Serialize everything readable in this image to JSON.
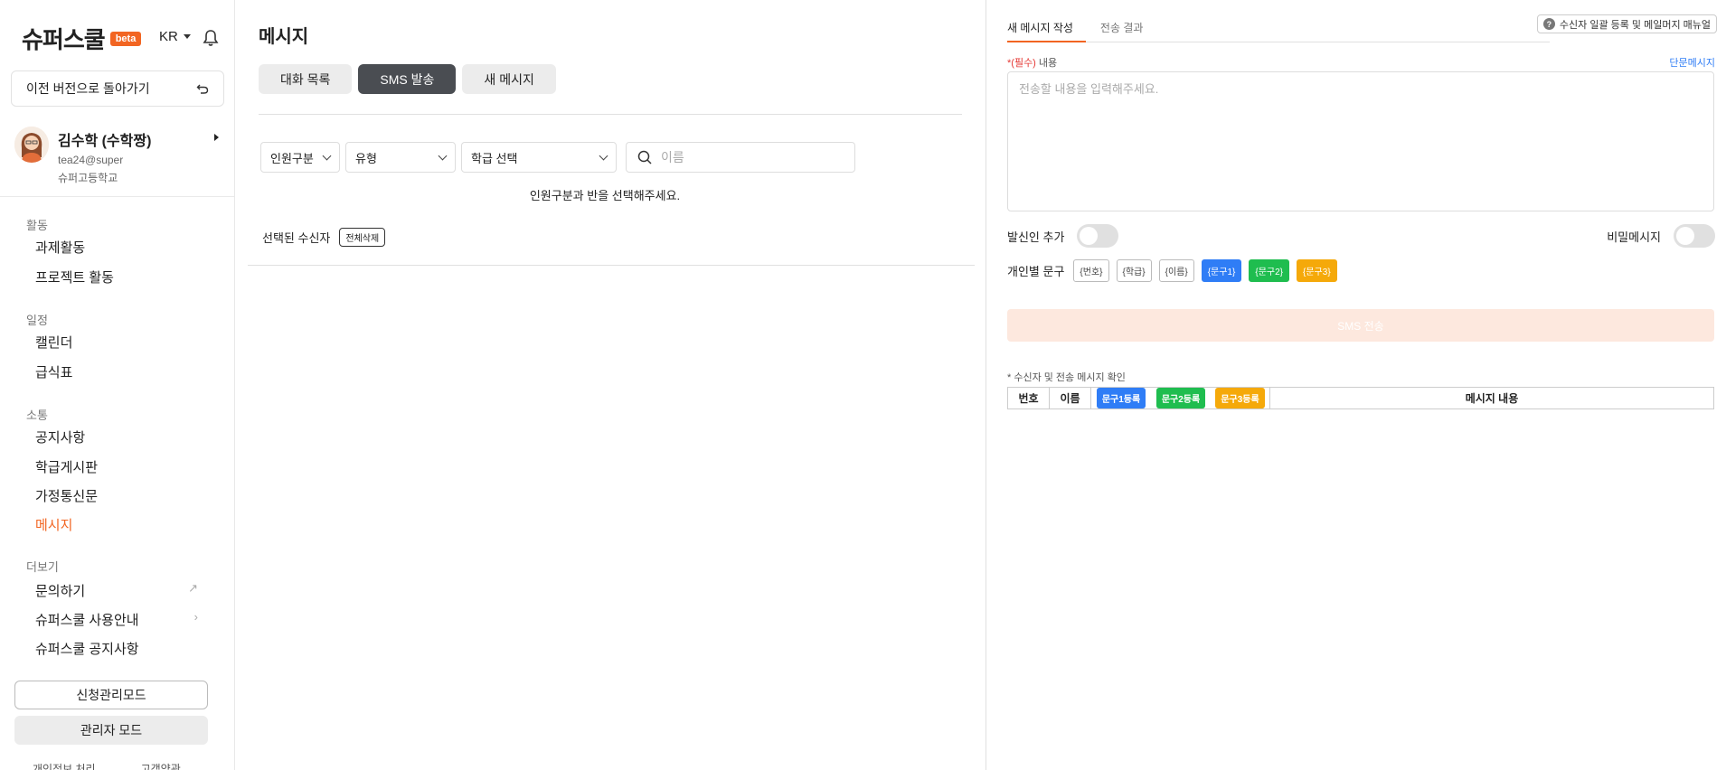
{
  "sidebar": {
    "logo": "슈퍼스쿨",
    "beta": "beta",
    "lang": "KR",
    "back_button": "이전 버전으로 돌아가기",
    "profile": {
      "name": "김수학 (수학짱)",
      "email": "tea24@super",
      "school": "슈퍼고등학교"
    },
    "sections": [
      {
        "label": "활동",
        "items": [
          "과제활동",
          "프로젝트 활동"
        ]
      },
      {
        "label": "일정",
        "items": [
          "캘린더",
          "급식표"
        ]
      },
      {
        "label": "소통",
        "items": [
          "공지사항",
          "학급게시판",
          "가정통신문",
          "메시지"
        ]
      },
      {
        "label": "더보기",
        "items": [
          "문의하기",
          "슈퍼스쿨 사용안내",
          "슈퍼스쿨 공지사항"
        ]
      }
    ],
    "modes": {
      "apply": "신청관리모드",
      "admin": "관리자 모드"
    },
    "footer": [
      "개인정보 처리",
      "고객약관"
    ]
  },
  "main": {
    "title": "메시지",
    "tabs": [
      "대화 목록",
      "SMS 발송",
      "새 메시지"
    ],
    "active_tab": "SMS 발송",
    "filters": {
      "member_type": "인원구분",
      "type": "유형",
      "class": "학급 선택"
    },
    "search_placeholder": "이름",
    "hint": "인원구분과 반을 선택해주세요.",
    "selected_recipients": "선택된 수신자",
    "clear_all": "전체삭제"
  },
  "compose": {
    "tabs": [
      "새 메시지 작성",
      "전송 결과"
    ],
    "manual_button": "수신자 일괄 등록 및 메일머지 매뉴얼",
    "required_prefix": "*(필수)",
    "content_label": "내용",
    "short_message_link": "단문메시지",
    "content_placeholder": "전송할 내용을 입력해주세요.",
    "sender_add": "발신인 추가",
    "secret_message": "비밀메시지",
    "personal_phrase": "개인별 문구",
    "phrase_tags": [
      "{번호}",
      "{학급}",
      "{이름}",
      "{문구1}",
      "{문구2}",
      "{문구3}"
    ],
    "send_button": "SMS 전송",
    "confirm_label": "* 수신자 및 전송 메시지 확인",
    "table_headers": {
      "no": "번호",
      "name": "이름",
      "reg1": "문구1등록",
      "reg2": "문구2등록",
      "reg3": "문구3등록",
      "content": "메시지 내용"
    }
  },
  "colors": {
    "accent": "#f26522",
    "blue": "#2f7df6",
    "green": "#1fbd4f",
    "yellow": "#f5a90a",
    "active_tab": "#4a4d52"
  }
}
